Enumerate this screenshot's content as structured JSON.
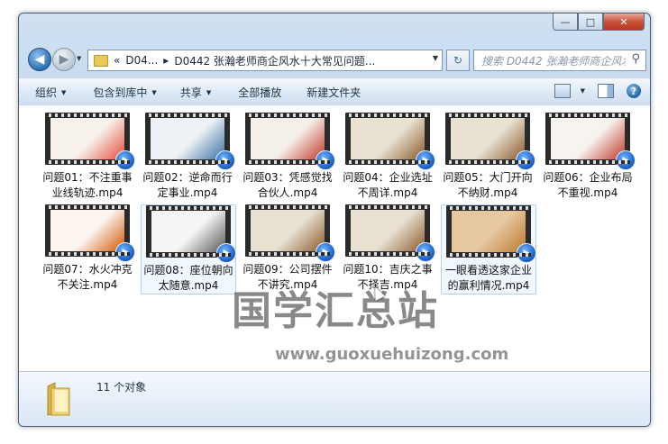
{
  "window": {
    "caption_buttons": {
      "minimize": "—",
      "maximize": "□",
      "close": "✕"
    }
  },
  "nav": {
    "back_icon": "◀",
    "forward_icon": "▶",
    "dropdown_icon": "▼",
    "address": {
      "sep1": "«",
      "crumb1": "D04...",
      "sep2": "▸",
      "crumb2": "D0442 张瀚老师商企风水十大常见问题..."
    },
    "refresh_icon": "↻",
    "search_placeholder": "搜索 D0442 张瀚老师商企风水...",
    "search_icon": "⚲"
  },
  "toolbar": {
    "organize": "组织",
    "include_library": "包含到库中",
    "share": "共享",
    "play_all": "全部播放",
    "new_folder": "新建文件夹",
    "arrow": "▼",
    "help": "?"
  },
  "files": [
    {
      "name": "问题01：不注重事业线轨迹.mp4",
      "accent": "#e64b3c",
      "bg": "#f6f1ea"
    },
    {
      "name": "问题02：逆命而行定事业.mp4",
      "accent": "#3a6ea5",
      "bg": "#eef2f6"
    },
    {
      "name": "问题03：凭感觉找合伙人.mp4",
      "accent": "#c0392b",
      "bg": "#f4efe8"
    },
    {
      "name": "问题04：企业选址不周详.mp4",
      "accent": "#8a5a2b",
      "bg": "#e9e2d3"
    },
    {
      "name": "问题05：大门开向不纳财.mp4",
      "accent": "#8a5a2b",
      "bg": "#e9e2d3"
    },
    {
      "name": "问题06：企业布局不重视.mp4",
      "accent": "#c0392b",
      "bg": "#f7f3ef"
    },
    {
      "name": "问题07：水火冲克不关注.mp4",
      "accent": "#d35400",
      "bg": "#fbf4ef"
    },
    {
      "name": "问题08：座位朝向太随意.mp4",
      "accent": "#555555",
      "bg": "#f5f5f5"
    },
    {
      "name": "问题09：公司摆件不讲究.mp4",
      "accent": "#8a5a2b",
      "bg": "#e9e2d3"
    },
    {
      "name": "问题10：吉庆之事不择吉.mp4",
      "accent": "#8a5a2b",
      "bg": "#e9e2d3"
    },
    {
      "name": "一眼看透这家企业的赢利情况.mp4",
      "accent": "#b9772b",
      "bg": "#e6c7a0"
    }
  ],
  "play_badge": "▶",
  "status": {
    "count": "11 个对象"
  },
  "watermark": {
    "cn": "国学汇总站",
    "url": "www.guoxuehuizong.com"
  }
}
